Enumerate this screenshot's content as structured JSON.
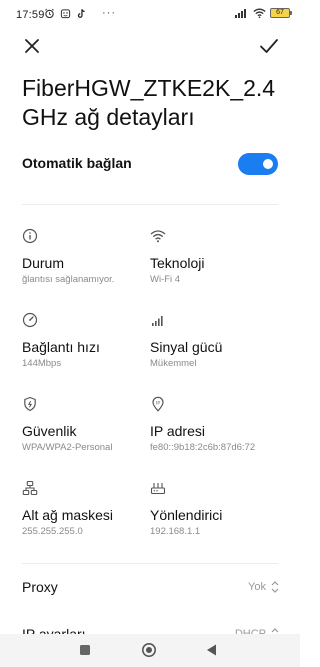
{
  "status_bar": {
    "time": "17:59",
    "dots": "···",
    "battery": "67",
    "icons": [
      "alarm-icon",
      "face-icon",
      "tiktok-icon",
      "signal-icon",
      "wifi-icon",
      "battery-icon"
    ]
  },
  "header": {
    "close_icon": "close-icon",
    "confirm_icon": "check-icon"
  },
  "title": "FiberHGW_ZTKE2K_2.4 GHz ağ detayları",
  "auto_connect": {
    "label": "Otomatik bağlan",
    "enabled": true
  },
  "details": [
    {
      "icon": "info-icon",
      "label": "Durum",
      "value": "ğlantısı sağlanamıyor."
    },
    {
      "icon": "wifi-icon",
      "label": "Teknoloji",
      "value": "Wi-Fi 4"
    },
    {
      "icon": "speedometer-icon",
      "label": "Bağlantı hızı",
      "value": "144Mbps"
    },
    {
      "icon": "signal-bars-icon",
      "label": "Sinyal gücü",
      "value": "Mükemmel"
    },
    {
      "icon": "shield-icon",
      "label": "Güvenlik",
      "value": "WPA/WPA2-Personal"
    },
    {
      "icon": "location-pin-icon",
      "label": "IP adresi",
      "value": "fe80::9b18:2c6b:87d6:72"
    },
    {
      "icon": "network-tree-icon",
      "label": "Alt ağ maskesi",
      "value": "255.255.255.0"
    },
    {
      "icon": "router-icon",
      "label": "Yönlendirici",
      "value": "192.168.1.1"
    }
  ],
  "proxy": {
    "label": "Proxy",
    "value": "Yok"
  },
  "ip_settings": {
    "label": "IP ayarları",
    "value": "DHCP"
  },
  "nav": {
    "icons": [
      "square-icon",
      "circle-home-icon",
      "triangle-back-icon"
    ]
  },
  "colors": {
    "accent": "#1a7df2",
    "secondary_text": "#8a8a8a",
    "divider": "#ececec"
  }
}
